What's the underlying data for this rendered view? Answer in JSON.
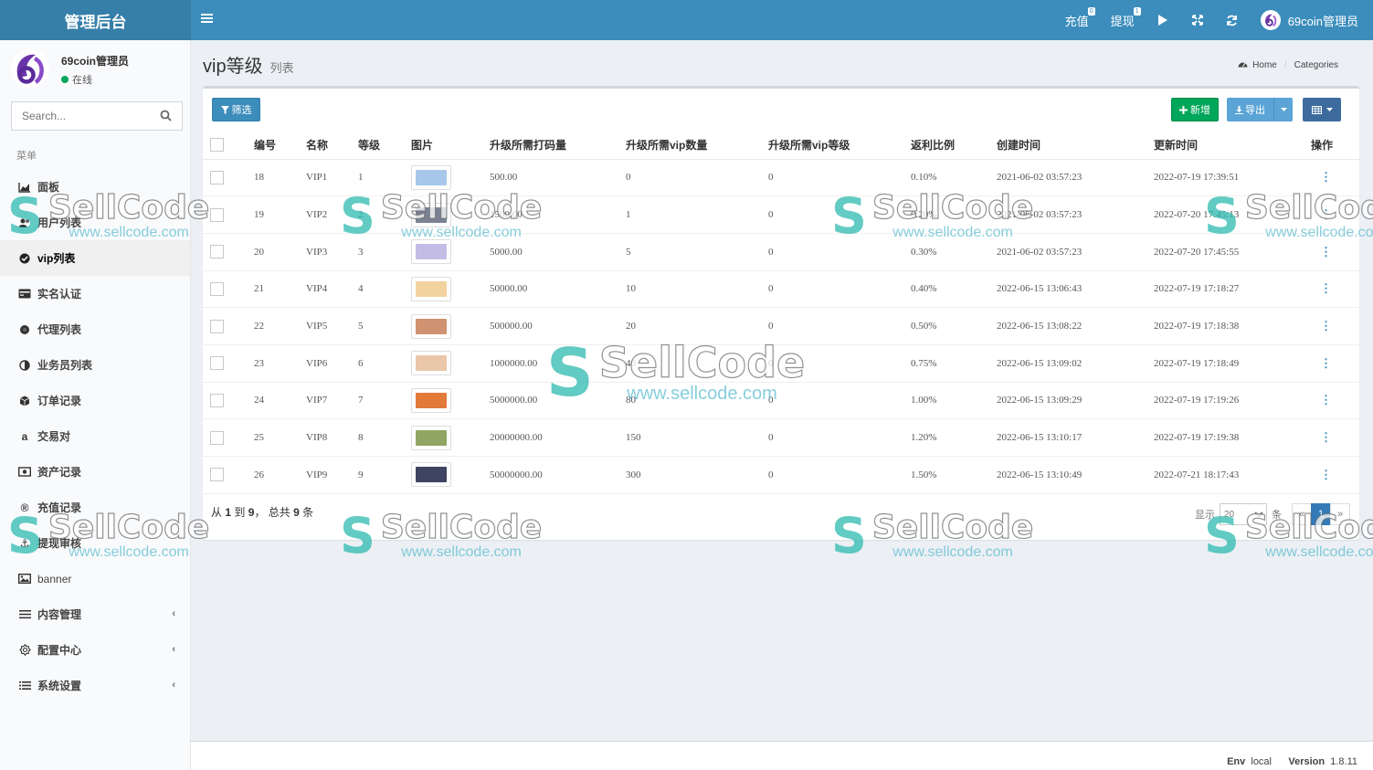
{
  "header": {
    "logo": "管理后台",
    "recharge": {
      "label": "充值",
      "badge": "0"
    },
    "withdraw": {
      "label": "提现",
      "badge": "1"
    },
    "user": "69coin管理员"
  },
  "sidebar": {
    "user_name": "69coin管理员",
    "status": "在线",
    "search_placeholder": "Search...",
    "menu_header": "菜单",
    "items": [
      {
        "label": "面板",
        "icon": "area-chart-icon"
      },
      {
        "label": "用户列表",
        "icon": "users-icon"
      },
      {
        "label": "vip列表",
        "icon": "check-circle-icon"
      },
      {
        "label": "实名认证",
        "icon": "id-card-icon"
      },
      {
        "label": "代理列表",
        "icon": "circle-icon"
      },
      {
        "label": "业务员列表",
        "icon": "half-circle-icon"
      },
      {
        "label": "订单记录",
        "icon": "cube-icon"
      },
      {
        "label": "交易对",
        "icon": "amazon-icon"
      },
      {
        "label": "资产记录",
        "icon": "money-icon"
      },
      {
        "label": "充值记录",
        "icon": "registered-icon"
      },
      {
        "label": "提现审核",
        "icon": "anchor-icon"
      },
      {
        "label": "banner",
        "icon": "image-icon"
      },
      {
        "label": "内容管理",
        "icon": "list-icon"
      },
      {
        "label": "配置中心",
        "icon": "gear-outline-icon"
      },
      {
        "label": "系统设置",
        "icon": "list-lines-icon"
      }
    ]
  },
  "page": {
    "title": "vip等级",
    "subtitle": "列表",
    "breadcrumb_home": "Home",
    "breadcrumb_current": "Categories"
  },
  "toolbar": {
    "filter": "筛选",
    "new": "新增",
    "export": "导出"
  },
  "table": {
    "columns": [
      "编号",
      "名称",
      "等级",
      "图片",
      "升级所需打码量",
      "升级所需vip数量",
      "升级所需vip等级",
      "返利比例",
      "创建时间",
      "更新时间",
      "操作"
    ],
    "rows": [
      {
        "id": "18",
        "name": "VIP1",
        "level": "1",
        "bet": "500.00",
        "vipcount": "0",
        "viplevel": "0",
        "rebate": "0.10%",
        "created": "2021-06-02 03:57:23",
        "updated": "2022-07-19 17:39:51",
        "color": "#a6c7ea"
      },
      {
        "id": "19",
        "name": "VIP2",
        "level": "2",
        "bet": "1500.00",
        "vipcount": "1",
        "viplevel": "0",
        "rebate": "0.20%",
        "created": "2021-06-02 03:57:23",
        "updated": "2022-07-20 17:45:13",
        "color": "#7a8294"
      },
      {
        "id": "20",
        "name": "VIP3",
        "level": "3",
        "bet": "5000.00",
        "vipcount": "5",
        "viplevel": "0",
        "rebate": "0.30%",
        "created": "2021-06-02 03:57:23",
        "updated": "2022-07-20 17:45:55",
        "color": "#c3bde6"
      },
      {
        "id": "21",
        "name": "VIP4",
        "level": "4",
        "bet": "50000.00",
        "vipcount": "10",
        "viplevel": "0",
        "rebate": "0.40%",
        "created": "2022-06-15 13:06:43",
        "updated": "2022-07-19 17:18:27",
        "color": "#f2d3a0"
      },
      {
        "id": "22",
        "name": "VIP5",
        "level": "5",
        "bet": "500000.00",
        "vipcount": "20",
        "viplevel": "0",
        "rebate": "0.50%",
        "created": "2022-06-15 13:08:22",
        "updated": "2022-07-19 17:18:38",
        "color": "#d09270"
      },
      {
        "id": "23",
        "name": "VIP6",
        "level": "6",
        "bet": "1000000.00",
        "vipcount": "40",
        "viplevel": "0",
        "rebate": "0.75%",
        "created": "2022-06-15 13:09:02",
        "updated": "2022-07-19 17:18:49",
        "color": "#e9c7a8"
      },
      {
        "id": "24",
        "name": "VIP7",
        "level": "7",
        "bet": "5000000.00",
        "vipcount": "80",
        "viplevel": "0",
        "rebate": "1.00%",
        "created": "2022-06-15 13:09:29",
        "updated": "2022-07-19 17:19:26",
        "color": "#e27a3a"
      },
      {
        "id": "25",
        "name": "VIP8",
        "level": "8",
        "bet": "20000000.00",
        "vipcount": "150",
        "viplevel": "0",
        "rebate": "1.20%",
        "created": "2022-06-15 13:10:17",
        "updated": "2022-07-19 17:19:38",
        "color": "#90a564"
      },
      {
        "id": "26",
        "name": "VIP9",
        "level": "9",
        "bet": "50000000.00",
        "vipcount": "300",
        "viplevel": "0",
        "rebate": "1.50%",
        "created": "2022-06-15 13:10:49",
        "updated": "2022-07-21 18:17:43",
        "color": "#3d4360"
      }
    ],
    "info_prefix": "从",
    "info_from": "1",
    "info_to_word": "到",
    "info_to": "9",
    "info_total_word": "， 总共",
    "info_total": "9",
    "info_suffix": "条"
  },
  "pagination": {
    "show_label": "显示",
    "page_size": "20",
    "unit": "条",
    "prev": "«",
    "current": "1",
    "next": "»"
  },
  "footer": {
    "env_label": "Env",
    "env_value": "local",
    "version_label": "Version",
    "version_value": "1.8.11"
  },
  "watermark": {
    "brand": "SellCode",
    "url": "www.sellcode.com"
  },
  "colors": {
    "header": "#3c8dbc",
    "logo_bg": "#367fa9",
    "success": "#00a65a"
  }
}
